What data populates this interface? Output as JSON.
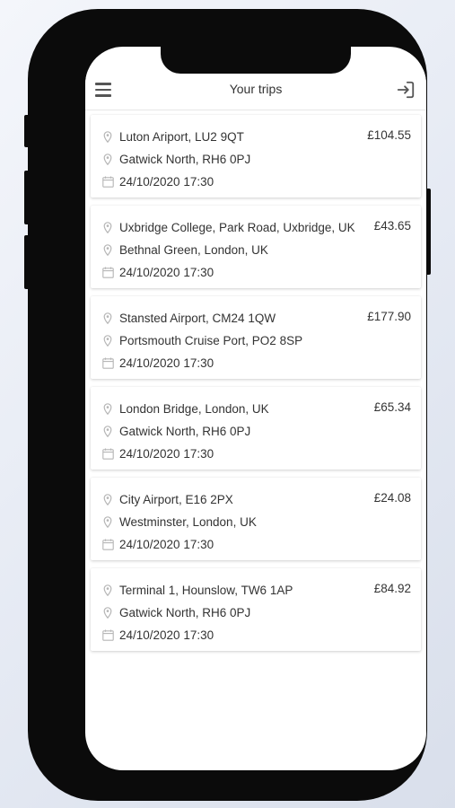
{
  "header": {
    "title": "Your trips"
  },
  "trips": [
    {
      "from": "Luton Ariport, LU2 9QT",
      "to": "Gatwick North, RH6 0PJ",
      "datetime": "24/10/2020 17:30",
      "price": "£104.55"
    },
    {
      "from": "Uxbridge College, Park Road, Uxbridge, UK",
      "to": "Bethnal Green, London, UK",
      "datetime": "24/10/2020 17:30",
      "price": "£43.65"
    },
    {
      "from": "Stansted Airport, CM24 1QW",
      "to": "Portsmouth Cruise Port, PO2 8SP",
      "datetime": "24/10/2020 17:30",
      "price": "£177.90"
    },
    {
      "from": "London Bridge, London, UK",
      "to": "Gatwick North, RH6 0PJ",
      "datetime": "24/10/2020 17:30",
      "price": "£65.34"
    },
    {
      "from": "City Airport, E16 2PX",
      "to": "Westminster, London, UK",
      "datetime": "24/10/2020 17:30",
      "price": "£24.08"
    },
    {
      "from": "Terminal 1, Hounslow, TW6 1AP",
      "to": "Gatwick North, RH6 0PJ",
      "datetime": "24/10/2020 17:30",
      "price": "£84.92"
    }
  ],
  "icons": {
    "menu": "hamburger-icon",
    "logout": "logout-icon",
    "location": "map-pin-icon",
    "date": "calendar-icon"
  },
  "colors": {
    "text": "#333333",
    "icon": "#b5b5b5",
    "frame": "#0b0b0b"
  }
}
